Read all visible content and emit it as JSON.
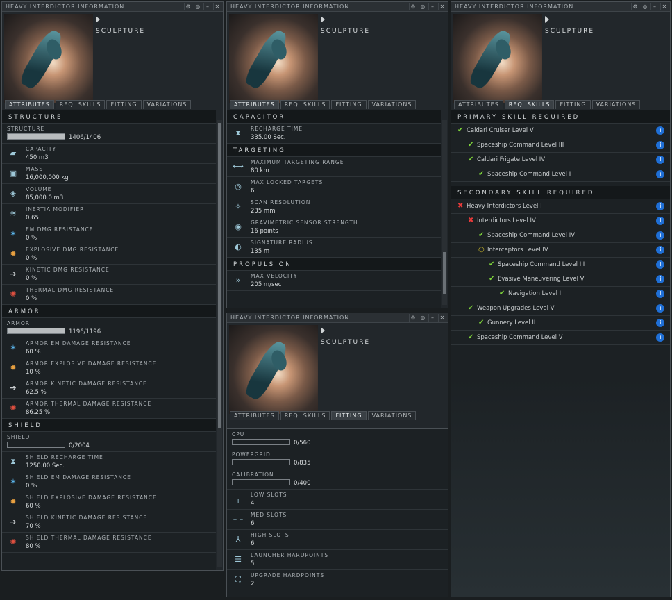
{
  "window_title": "HEAVY INTERDICTOR INFORMATION",
  "ship_name": "SCULPTURE",
  "tabs": [
    "ATTRIBUTES",
    "REQ. SKILLS",
    "FITTING",
    "VARIATIONS"
  ],
  "title_buttons": [
    "⚙",
    "◎",
    "–",
    "✕"
  ],
  "attr": {
    "structure_section": "STRUCTURE",
    "structure": {
      "label": "STRUCTURE",
      "value": "1406/1406",
      "fill": 1.0
    },
    "rows1": [
      {
        "icon": "capacity-icon",
        "glyph": "▰",
        "label": "CAPACITY",
        "value": "450 m3"
      },
      {
        "icon": "mass-icon",
        "glyph": "▣",
        "label": "MASS",
        "value": "16,000,000 kg"
      },
      {
        "icon": "volume-icon",
        "glyph": "◈",
        "label": "VOLUME",
        "value": "85,000.0 m3"
      },
      {
        "icon": "inertia-icon",
        "glyph": "≋",
        "label": "INERTIA MODIFIER",
        "value": "0.65"
      },
      {
        "icon": "em-resist-icon",
        "glyph": "✶",
        "label": "EM DMG RESISTANCE",
        "value": "0 %"
      },
      {
        "icon": "explosive-resist-icon",
        "glyph": "✹",
        "label": "EXPLOSIVE DMG RESISTANCE",
        "value": "0 %"
      },
      {
        "icon": "kinetic-resist-icon",
        "glyph": "➔",
        "label": "KINETIC DMG RESISTANCE",
        "value": "0 %"
      },
      {
        "icon": "thermal-resist-icon",
        "glyph": "✺",
        "label": "THERMAL DMG RESISTANCE",
        "value": "0 %"
      }
    ],
    "armor_section": "ARMOR",
    "armor": {
      "label": "ARMOR",
      "value": "1196/1196",
      "fill": 1.0
    },
    "rows2": [
      {
        "icon": "em-resist-icon",
        "glyph": "✶",
        "label": "ARMOR EM DAMAGE RESISTANCE",
        "value": "60 %"
      },
      {
        "icon": "explosive-resist-icon",
        "glyph": "✹",
        "label": "ARMOR EXPLOSIVE DAMAGE RESISTANCE",
        "value": "10 %"
      },
      {
        "icon": "kinetic-resist-icon",
        "glyph": "➔",
        "label": "ARMOR KINETIC DAMAGE RESISTANCE",
        "value": "62.5 %"
      },
      {
        "icon": "thermal-resist-icon",
        "glyph": "✺",
        "label": "ARMOR THERMAL DAMAGE RESISTANCE",
        "value": "86.25 %"
      }
    ],
    "shield_section": "SHIELD",
    "shield": {
      "label": "SHIELD",
      "value": "0/2004",
      "fill": 0.0
    },
    "rows3": [
      {
        "icon": "hourglass-icon",
        "glyph": "⧗",
        "label": "SHIELD RECHARGE TIME",
        "value": "1250.00 Sec."
      },
      {
        "icon": "em-resist-icon",
        "glyph": "✶",
        "label": "SHIELD EM DAMAGE RESISTANCE",
        "value": "0 %"
      },
      {
        "icon": "explosive-resist-icon",
        "glyph": "✹",
        "label": "SHIELD EXPLOSIVE DAMAGE RESISTANCE",
        "value": "60 %"
      },
      {
        "icon": "kinetic-resist-icon",
        "glyph": "➔",
        "label": "SHIELD KINETIC DAMAGE RESISTANCE",
        "value": "70 %"
      },
      {
        "icon": "thermal-resist-icon",
        "glyph": "✺",
        "label": "SHIELD THERMAL DAMAGE RESISTANCE",
        "value": "80 %"
      }
    ]
  },
  "attr2": {
    "capacitor_section": "CAPACITOR",
    "cap_rows": [
      {
        "icon": "hourglass-icon",
        "glyph": "⧗",
        "label": "RECHARGE TIME",
        "value": "335.00 Sec."
      }
    ],
    "targeting_section": "TARGETING",
    "tgt_rows": [
      {
        "icon": "targeting-range-icon",
        "glyph": "⟷",
        "label": "MAXIMUM TARGETING RANGE",
        "value": "80 km"
      },
      {
        "icon": "locked-targets-icon",
        "glyph": "◎",
        "label": "MAX LOCKED TARGETS",
        "value": "6"
      },
      {
        "icon": "scan-resolution-icon",
        "glyph": "✧",
        "label": "SCAN RESOLUTION",
        "value": "235 mm"
      },
      {
        "icon": "sensor-strength-icon",
        "glyph": "◉",
        "label": "GRAVIMETRIC SENSOR STRENGTH",
        "value": "16 points"
      },
      {
        "icon": "signature-radius-icon",
        "glyph": "◐",
        "label": "SIGNATURE RADIUS",
        "value": "135 m"
      }
    ],
    "propulsion_section": "PROPULSION",
    "prop_rows": [
      {
        "icon": "velocity-icon",
        "glyph": "»",
        "label": "MAX VELOCITY",
        "value": "205 m/sec"
      }
    ]
  },
  "fitting": {
    "bars": [
      {
        "label": "CPU",
        "value": "0/560",
        "fill": 0.0
      },
      {
        "label": "POWERGRID",
        "value": "0/835",
        "fill": 0.0
      },
      {
        "label": "CALIBRATION",
        "value": "0/400",
        "fill": 0.0
      }
    ],
    "rows": [
      {
        "icon": "low-slots-icon",
        "glyph": "╷",
        "label": "LOW SLOTS",
        "value": "4"
      },
      {
        "icon": "med-slots-icon",
        "glyph": "– –",
        "label": "MED SLOTS",
        "value": "6"
      },
      {
        "icon": "high-slots-icon",
        "glyph": "⅄",
        "label": "HIGH SLOTS",
        "value": "6"
      },
      {
        "icon": "launcher-hardpoints-icon",
        "glyph": "☰",
        "label": "LAUNCHER HARDPOINTS",
        "value": "5"
      },
      {
        "icon": "upgrade-hardpoints-icon",
        "glyph": "⛶",
        "label": "UPGRADE HARDPOINTS",
        "value": "2"
      }
    ]
  },
  "skills": {
    "primary_section": "PRIMARY SKILL REQUIRED",
    "primary": [
      {
        "status": "ok",
        "indent": 0,
        "name": "Caldari Cruiser Level V"
      },
      {
        "status": "ok",
        "indent": 1,
        "name": "Spaceship Command Level III"
      },
      {
        "status": "ok",
        "indent": 1,
        "name": "Caldari Frigate Level IV"
      },
      {
        "status": "ok",
        "indent": 2,
        "name": "Spaceship Command Level I"
      }
    ],
    "secondary_section": "SECONDARY SKILL REQUIRED",
    "secondary": [
      {
        "status": "no",
        "indent": 0,
        "name": "Heavy Interdictors Level I"
      },
      {
        "status": "no",
        "indent": 1,
        "name": "Interdictors Level IV"
      },
      {
        "status": "ok",
        "indent": 2,
        "name": "Spaceship Command Level IV"
      },
      {
        "status": "pend",
        "indent": 2,
        "name": "Interceptors Level IV"
      },
      {
        "status": "ok",
        "indent": 3,
        "name": "Spaceship Command Level III"
      },
      {
        "status": "ok",
        "indent": 3,
        "name": "Evasive Maneuvering Level V"
      },
      {
        "status": "ok",
        "indent": 4,
        "name": "Navigation Level II"
      },
      {
        "status": "ok",
        "indent": 1,
        "name": "Weapon Upgrades Level V"
      },
      {
        "status": "ok",
        "indent": 2,
        "name": "Gunnery Level II"
      },
      {
        "status": "ok",
        "indent": 1,
        "name": "Spaceship Command Level V"
      }
    ],
    "info_glyph": "i",
    "status_glyphs": {
      "ok": "✔",
      "no": "✖",
      "pend": "○"
    }
  }
}
